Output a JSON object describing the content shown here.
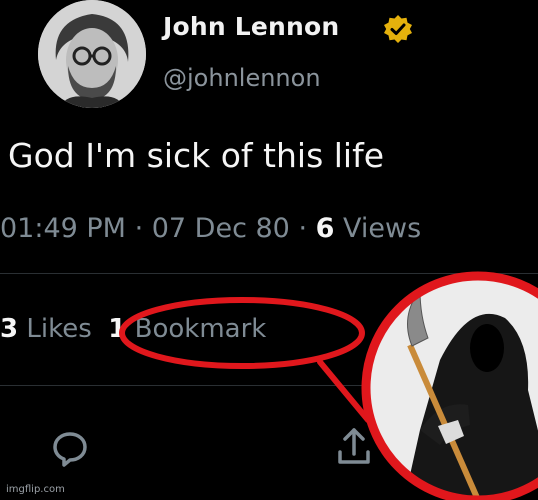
{
  "tweet": {
    "display_name": "John Lennon",
    "handle": "@johnlennon",
    "text": "God I'm sick of this life",
    "time": "01:49 PM",
    "date": "07 Dec 80",
    "views_count": "6",
    "views_label": "Views"
  },
  "stats": {
    "likes_count": "3",
    "likes_label": "Likes",
    "bookmarks_count": "1",
    "bookmarks_label": "Bookmark"
  },
  "watermark": "imgflip.com",
  "icons": {
    "verified": "verified-badge-icon",
    "reply": "reply-icon",
    "share": "share-icon"
  },
  "colors": {
    "background": "#000000",
    "verified_badge": "#e5b10c",
    "highlight": "#e0171c",
    "muted_text": "#7f8b94"
  }
}
